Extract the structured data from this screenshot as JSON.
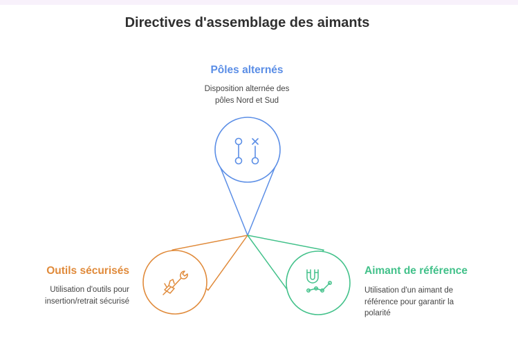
{
  "title": "Directives d'assemblage des aimants",
  "colors": {
    "blue": "#5b8ee6",
    "orange": "#e08a3a",
    "green": "#42c18a",
    "text_dark": "#2f2f2f",
    "text_muted": "#444444"
  },
  "nodes": {
    "top": {
      "heading": "Pôles alternés",
      "description_lines": [
        "Disposition alternée des",
        "pôles Nord et Sud"
      ],
      "icon": "alternating-poles-icon"
    },
    "left": {
      "heading": "Outils sécurisés",
      "description_lines": [
        "Utilisation d'outils pour",
        "insertion/retrait sécurisé"
      ],
      "icon": "hand-wrench-icon"
    },
    "right": {
      "heading": "Aimant de référence",
      "description_lines": [
        "Utilisation d'un aimant de",
        "référence pour garantir la",
        "polarité"
      ],
      "icon": "magnet-chart-icon"
    }
  }
}
